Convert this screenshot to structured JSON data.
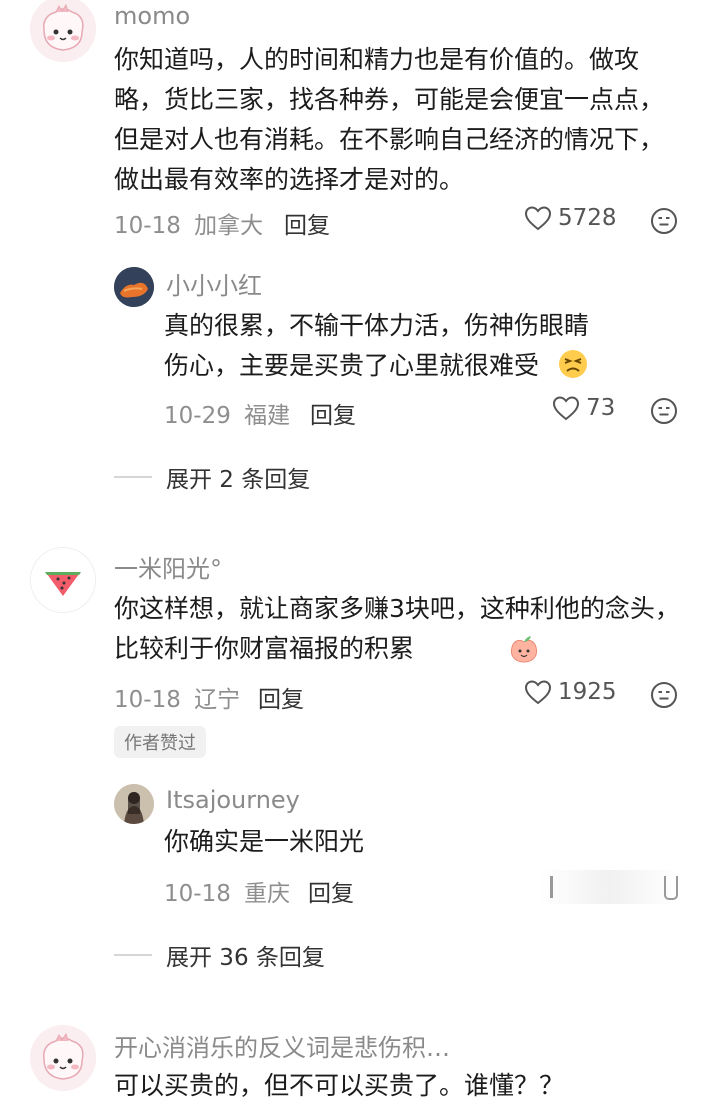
{
  "comments": [
    {
      "username": "momo",
      "text": "你知道吗，人的时间和精力也是有价值的。做攻略，货比三家，找各种券，可能是会便宜一点点，但是对人也有消耗。在不影响自己经济的情况下，做出最有效率的选择才是对的。",
      "date": "10-18",
      "location": "加拿大",
      "reply_label": "回复",
      "likes": "5728",
      "reply": {
        "username": "小小小红",
        "text": "真的很累，不输干体力活，伤神伤眼睛伤心，主要是买贵了心里就很难受",
        "date": "10-29",
        "location": "福建",
        "reply_label": "回复",
        "likes": "73"
      },
      "expand_label": "展开 2 条回复"
    },
    {
      "username": "一米阳光°",
      "text": "你这样想，就让商家多赚3块吧，这种利他的念头，比较利于你财富福报的积累",
      "date": "10-18",
      "location": "辽宁",
      "reply_label": "回复",
      "likes": "1925",
      "badge": "作者赞过",
      "reply": {
        "username": "Itsajourney",
        "text": "你确实是一米阳光",
        "date": "10-18",
        "location": "重庆",
        "reply_label": "回复"
      },
      "expand_label": "展开 36 条回复"
    },
    {
      "username": "开心消消乐的反义词是悲伤积…",
      "text": "可以买贵的，但不可以买贵了。谁懂？？"
    }
  ]
}
